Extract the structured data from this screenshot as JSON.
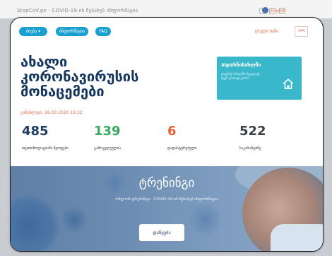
{
  "page_header": {
    "title": "StopCoV.ge - COVID-19-ის შესახებ ინფორმაცია",
    "language": "English"
  },
  "nav": {
    "menu_button": "ძიება ▾",
    "button_2": "ინფორმაცია",
    "button_3": "FAQ",
    "right_text": "ცხელი ხაზი",
    "right_box": "144"
  },
  "hero": {
    "title_line1": "ახალი",
    "title_line2": "კორონავირუსის",
    "title_line3": "მონაცემები",
    "updated": "განახლდა: 26.03.2020 19:32"
  },
  "promo": {
    "title": "#დარჩისახლში",
    "description": "ვიყენებ სახლში ჩვეულებ, ჩვენ ერთად ვართ",
    "icon": "home-icon"
  },
  "stats": [
    {
      "value": "485",
      "label": "თვითიზოლაციაში მყოფები",
      "color": "#1f3c63"
    },
    {
      "value": "139",
      "label": "გამოკვლეულია",
      "color": "#3aa861"
    },
    {
      "value": "6",
      "label": "დადასტურებული",
      "color": "#e8643f"
    },
    {
      "value": "522",
      "label": "საკარანტინე",
      "color": "#3a3f45"
    }
  ],
  "banner": {
    "title": "ტრენინგი",
    "subtitle": "ონლაინ ტრენინგი - COVID-19-ის შესახებ ინფორმაცია",
    "button": "დაწყება"
  }
}
